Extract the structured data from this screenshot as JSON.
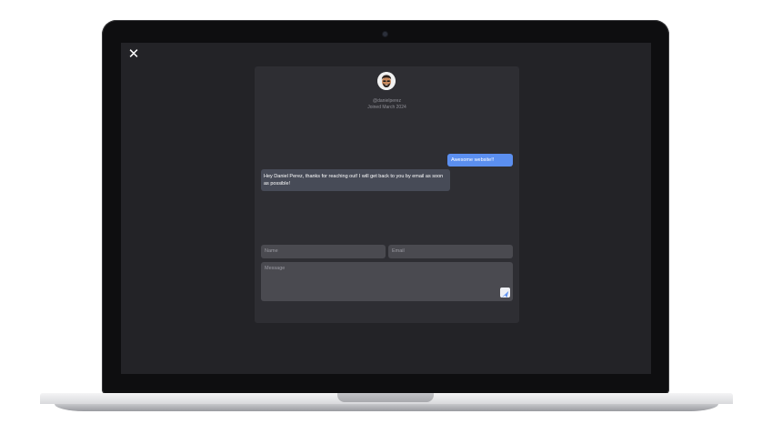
{
  "profile": {
    "handle": "@danielperez",
    "joined": "Joined March 2024"
  },
  "messages": {
    "outgoing": "Awesome website!!",
    "incoming": "Hey Daniel Perez, thanks for reaching out! I will get back to you by email as soon as possible!"
  },
  "form": {
    "name_placeholder": "Name",
    "email_placeholder": "Email",
    "message_placeholder": "Message"
  },
  "icons": {
    "close": "close-icon",
    "send": "send-icon",
    "avatar": "memoji-avatar"
  },
  "colors": {
    "screen_bg": "#232327",
    "panel_bg": "#2e2e33",
    "outgoing_bubble": "#5b8ff0",
    "incoming_bubble": "#474b57",
    "field_bg": "#4a4a50"
  }
}
